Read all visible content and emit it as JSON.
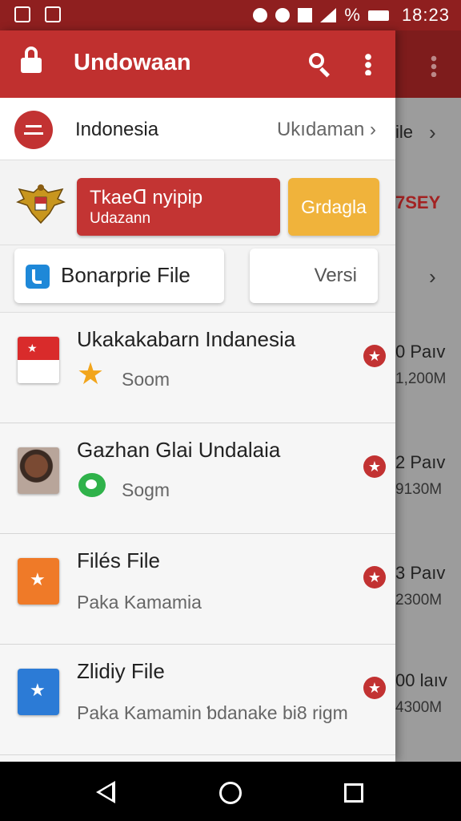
{
  "status_bar": {
    "time": "18:23",
    "battery_text": "%"
  },
  "app_bar": {
    "title": "Undowaan"
  },
  "country_row": {
    "name": "Indonesia",
    "right_label": "Ukıdaman"
  },
  "actions": {
    "red_button_line1": "Tkaeᗡ nyipip",
    "red_button_line2": "Udazann",
    "amber_button": "Grdagla"
  },
  "cards": {
    "file_label": "Bonarprie File",
    "versi_label": "Versi"
  },
  "list": [
    {
      "title": "Ukakakabarn Indanesia",
      "subtitle": "Soom",
      "thumb": "flag-icon",
      "badge": "star-icon"
    },
    {
      "title": "Gazhan Glai Undalaia",
      "subtitle": "Sogm",
      "thumb": "photo-thumbnail",
      "badge": "green-icon"
    },
    {
      "title": "Filés File",
      "subtitle": "Paka Kamamia",
      "thumb": "orange-file-icon",
      "badge": ""
    },
    {
      "title": "Zlidiy File",
      "subtitle": "Paka Kamamin ƅdanake bi8 rigm",
      "thumb": "blue-file-icon",
      "badge": ""
    }
  ],
  "background": {
    "file_label": "ile",
    "sey_label": "7SEY",
    "rows": [
      {
        "line1": "0 Paıv",
        "line2": "1,200M"
      },
      {
        "line1": "2 Paıv",
        "line2": "9130M"
      },
      {
        "line1": "3 Paıv",
        "line2": "2300M"
      },
      {
        "line1": "00 laıv",
        "line2": "4300M"
      }
    ]
  },
  "colors": {
    "primary": "#c0302f",
    "status_bar": "#8f1f1f",
    "amber": "#f0b33b"
  }
}
